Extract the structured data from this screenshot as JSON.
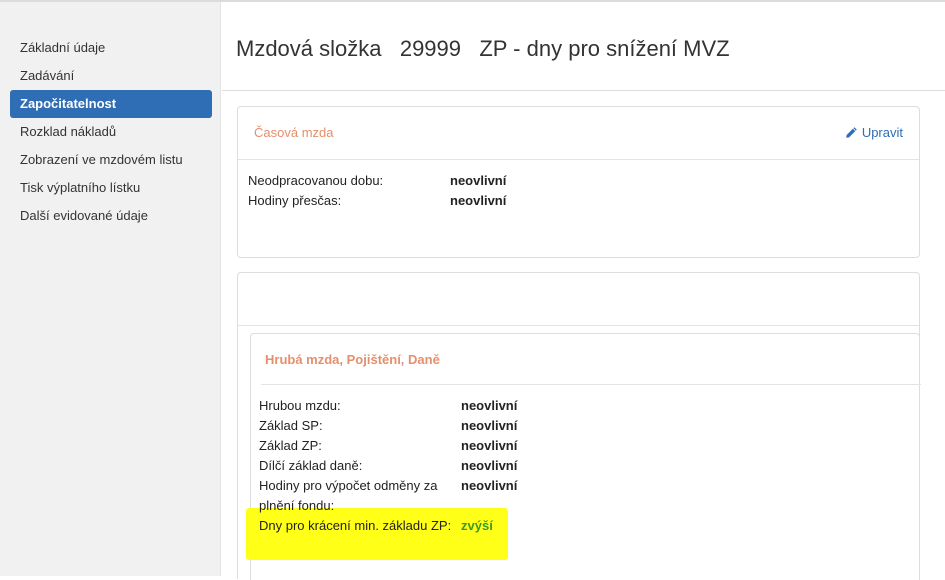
{
  "sidebar": {
    "items": [
      {
        "label": "Základní údaje",
        "active": false
      },
      {
        "label": "Zadávání",
        "active": false
      },
      {
        "label": "Započitatelnost",
        "active": true
      },
      {
        "label": "Rozklad nákladů",
        "active": false
      },
      {
        "label": "Zobrazení ve mzdovém listu",
        "active": false
      },
      {
        "label": "Tisk výplatního lístku",
        "active": false
      },
      {
        "label": "Další evidované údaje",
        "active": false
      }
    ]
  },
  "header": {
    "title": "Mzdová složka   29999   ZP - dny pro snížení MVZ"
  },
  "panel_casova": {
    "title": "Časová mzda",
    "edit_label": "Upravit",
    "rows": [
      {
        "label": "Neodpracovanou dobu:",
        "value": "neovlivní"
      },
      {
        "label": "Hodiny přesčas:",
        "value": "neovlivní"
      }
    ]
  },
  "panel_hruba": {
    "title": "Hrubá mzda, Pojištění, Daně",
    "rows": [
      {
        "label": "Hrubou mzdu:",
        "value": "neovlivní"
      },
      {
        "label": "Základ SP:",
        "value": "neovlivní"
      },
      {
        "label": "Základ ZP:",
        "value": "neovlivní"
      },
      {
        "label": "Dílčí základ daně:",
        "value": "neovlivní"
      },
      {
        "label": "Hodiny pro výpočet odměny za plnění fondu:",
        "value": "neovlivní"
      },
      {
        "label": "Dny pro krácení min. základu ZP:",
        "value": "zvýší"
      }
    ]
  },
  "colors": {
    "accent": "#2f6db5",
    "panel_title": "#e58f6c",
    "increase_value": "#3a9a2a",
    "highlight": "#ffff18"
  }
}
